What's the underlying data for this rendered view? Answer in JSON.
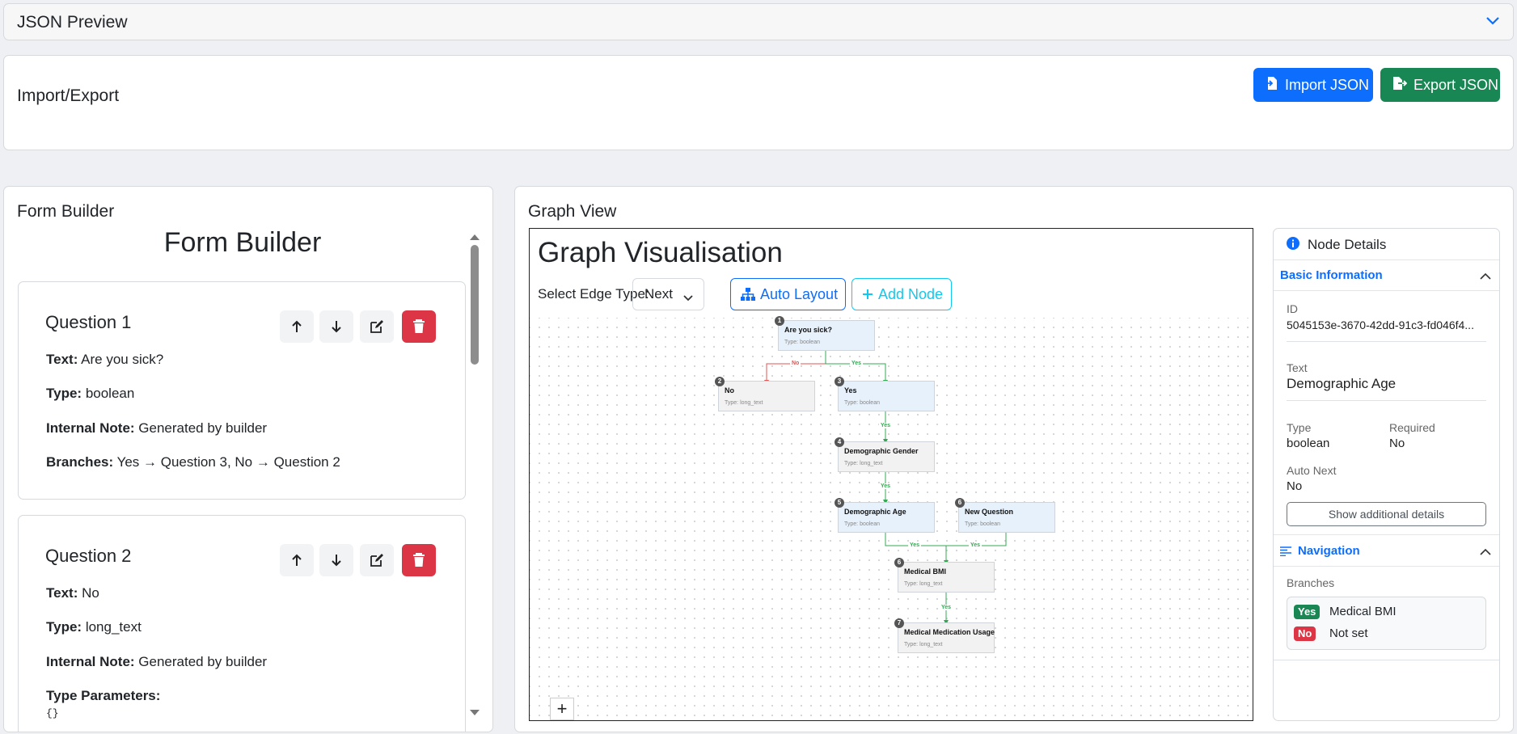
{
  "json_preview": {
    "title": "JSON Preview"
  },
  "import_export": {
    "title": "Import/Export",
    "import_label": "Import JSON",
    "export_label": "Export JSON"
  },
  "form_builder": {
    "header": "Form Builder",
    "title": "Form Builder",
    "questions": [
      {
        "title": "Question 1",
        "text_label": "Text:",
        "text": "Are you sick?",
        "type_label": "Type:",
        "type": "boolean",
        "note_label": "Internal Note:",
        "note": "Generated by builder",
        "branches_label": "Branches:",
        "branches": "Yes → Question 3, No → Question 2"
      },
      {
        "title": "Question 2",
        "text_label": "Text:",
        "text": "No",
        "type_label": "Type:",
        "type": "long_text",
        "note_label": "Internal Note:",
        "note": "Generated by builder",
        "params_label": "Type Parameters:",
        "params": "{}"
      }
    ]
  },
  "graph": {
    "header": "Graph View",
    "title": "Graph Visualisation",
    "edge_type_label": "Select Edge Type:",
    "edge_type_value": "Next",
    "auto_layout_label": "Auto Layout",
    "add_node_label": "Add Node",
    "zoom_in": "+",
    "nodes": [
      {
        "num": "1",
        "label": "Are you sick?",
        "type": "Type: boolean"
      },
      {
        "num": "2",
        "label": "No",
        "type": "Type: long_text"
      },
      {
        "num": "3",
        "label": "Yes",
        "type": "Type: boolean"
      },
      {
        "num": "4",
        "label": "Demographic Gender",
        "type": "Type: long_text"
      },
      {
        "num": "5",
        "label": "Demographic Age",
        "type": "Type: boolean"
      },
      {
        "num": "6",
        "label": "New Question",
        "type": "Type: boolean"
      },
      {
        "num": "6",
        "label": "Medical BMI",
        "type": "Type: long_text"
      },
      {
        "num": "7",
        "label": "Medical Medication Usage",
        "type": "Type: long_text"
      }
    ],
    "edge_labels": {
      "no": "No",
      "yes": "Yes"
    }
  },
  "details": {
    "title": "Node Details",
    "basic_title": "Basic Information",
    "id_label": "ID",
    "id_value": "5045153e-3670-42dd-91c3-fd046f4...",
    "text_label": "Text",
    "text_value": "Demographic Age",
    "type_label": "Type",
    "type_value": "boolean",
    "required_label": "Required",
    "required_value": "No",
    "auto_next_label": "Auto Next",
    "auto_next_value": "No",
    "more_label": "Show additional details",
    "nav_title": "Navigation",
    "branches_label": "Branches",
    "branch_yes_badge": "Yes",
    "branch_yes_value": "Medical BMI",
    "branch_no_badge": "No",
    "branch_no_value": "Not set"
  },
  "colors": {
    "primary": "#0d6efd",
    "success": "#198754",
    "danger": "#dc3545",
    "info": "#0dcaf0",
    "edge_yes": "#34a853",
    "edge_no": "#e05555"
  }
}
